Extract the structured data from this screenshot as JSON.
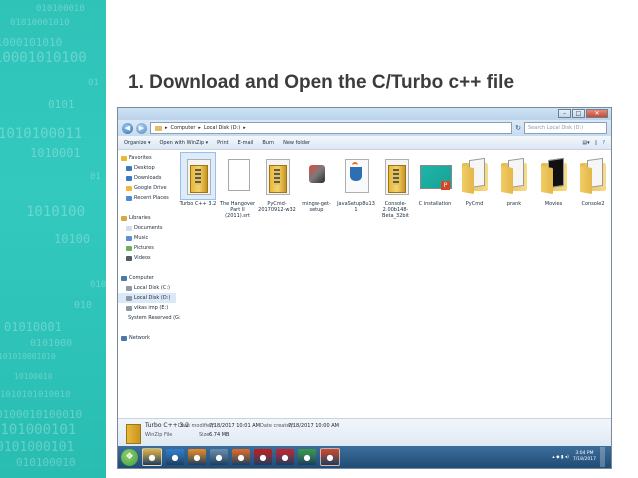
{
  "slide": {
    "heading": "1. Download and Open the C/Turbo c++ file",
    "binary_lines": [
      "010100010",
      "01010001010",
      "1000101010",
      "10001010100",
      "01",
      "0101",
      "1010100011",
      "1010001",
      "01",
      "1010100",
      "10100",
      "010",
      "010",
      "01010001",
      "0101000",
      "101010001010",
      "10100010",
      "1010101010010",
      "0100010100010",
      "0101000101",
      "0101000101",
      "010100010"
    ]
  },
  "explorer": {
    "address": [
      "Computer",
      "Local Disk (D:)"
    ],
    "search_placeholder": "Search Local Disk (D:)",
    "toolbar": [
      "Organize ▾",
      "Open with WinZip ▾",
      "Print",
      "E-mail",
      "Burn",
      "New folder"
    ],
    "nav": [
      {
        "label": "Favorites",
        "icon": "star-icon",
        "color": "#e8b830"
      },
      {
        "label": "Desktop",
        "icon": "desktop-icon",
        "color": "#3a78c2"
      },
      {
        "label": "Downloads",
        "icon": "downloads-icon",
        "color": "#3a78c2"
      },
      {
        "label": "Google Drive",
        "icon": "google-drive-icon",
        "color": "#f3b637"
      },
      {
        "label": "Recent Places",
        "icon": "recent-places-icon",
        "color": "#4f8ad0"
      },
      {
        "label": "",
        "icon": "",
        "color": ""
      },
      {
        "label": "Libraries",
        "icon": "libraries-icon",
        "color": "#d7a945"
      },
      {
        "label": "Documents",
        "icon": "documents-icon",
        "color": "#d0ddee"
      },
      {
        "label": "Music",
        "icon": "music-icon",
        "color": "#5a8fd0"
      },
      {
        "label": "Pictures",
        "icon": "pictures-icon",
        "color": "#6cae5e"
      },
      {
        "label": "Videos",
        "icon": "videos-icon",
        "color": "#555a66"
      },
      {
        "label": "",
        "icon": "",
        "color": ""
      },
      {
        "label": "Computer",
        "icon": "computer-icon",
        "color": "#4a78a8"
      },
      {
        "label": "Local Disk (C:)",
        "icon": "drive-icon",
        "color": "#8a9aaa"
      },
      {
        "label": "Local Disk (D:)",
        "icon": "drive-icon",
        "color": "#8a9aaa"
      },
      {
        "label": "vikas imp (E:)",
        "icon": "drive-icon",
        "color": "#8a9aaa"
      },
      {
        "label": "System Reserved (G:",
        "icon": "drive-icon",
        "color": "#8a9aaa"
      },
      {
        "label": "",
        "icon": "",
        "color": ""
      },
      {
        "label": "Network",
        "icon": "network-icon",
        "color": "#4a78a8"
      }
    ],
    "files": [
      {
        "name": "Turbo C++ 3.2",
        "type": "winzip",
        "selected": true
      },
      {
        "name": "The Hangover Part II (2011).srt",
        "type": "document",
        "selected": false
      },
      {
        "name": "PyCmd-20170912-w32",
        "type": "winzip",
        "selected": false
      },
      {
        "name": "mingw-get-setup",
        "type": "setup",
        "selected": false
      },
      {
        "name": "JavaSetup8u131",
        "type": "java",
        "selected": false
      },
      {
        "name": "Console-2.00b148-Beta_32bit",
        "type": "winzip",
        "selected": false
      },
      {
        "name": "C installation",
        "type": "slides",
        "selected": false
      },
      {
        "name": "PyCmd",
        "type": "folder",
        "selected": false
      },
      {
        "name": "prank",
        "type": "folder",
        "selected": false
      },
      {
        "name": "Movies",
        "type": "folder-dark",
        "selected": false
      },
      {
        "name": "Console2",
        "type": "folder",
        "selected": false
      }
    ],
    "details": {
      "name": "Turbo C++ 3.2",
      "modified_label": "Date modified:",
      "modified": "7/18/2017 10:01 AM",
      "created_label": "Date created:",
      "created": "7/18/2017 10:00 AM",
      "type": "WinZip File",
      "size_label": "Size:",
      "size": "6.74 MB"
    }
  },
  "taskbar": {
    "icons": [
      {
        "name": "start-orb-icon",
        "color": "#3f9c3f"
      },
      {
        "name": "explorer-icon",
        "color": "#e2b340"
      },
      {
        "name": "ie-icon",
        "color": "#2f7fcf"
      },
      {
        "name": "media-player-icon",
        "color": "#f08a1c"
      },
      {
        "name": "network-connect-icon",
        "color": "#6a8cad"
      },
      {
        "name": "firefox-icon",
        "color": "#e86a1e"
      },
      {
        "name": "acrobat-icon",
        "color": "#c41a1a"
      },
      {
        "name": "opera-icon",
        "color": "#cc1f2b"
      },
      {
        "name": "chrome-icon",
        "color": "#3a9a46"
      },
      {
        "name": "powerpoint-icon",
        "color": "#d24726"
      }
    ],
    "time": "3:04 PM",
    "date": "7/18/2017"
  }
}
